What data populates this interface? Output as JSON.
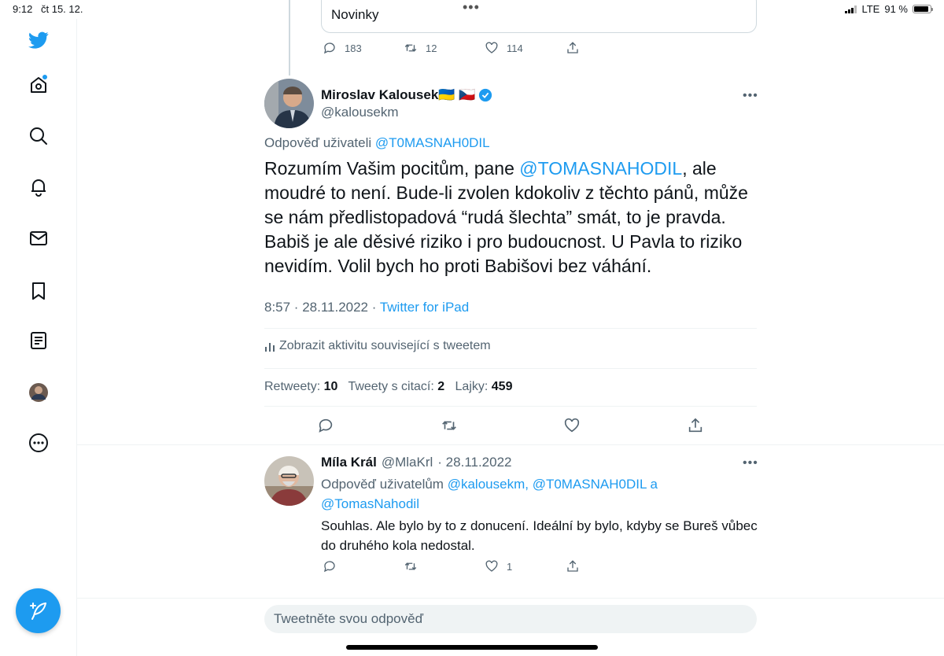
{
  "status_bar": {
    "time": "9:12",
    "date": "čt 15. 12.",
    "network": "LTE",
    "battery": "91 %",
    "battery_level": 0.91
  },
  "sidebar": {
    "items": [
      "twitter-logo",
      "home",
      "explore",
      "notifications",
      "messages",
      "bookmarks",
      "lists",
      "profile",
      "more"
    ],
    "compose_label": "Tweet"
  },
  "previous_tweet": {
    "card_text": "Novinky",
    "replies": "183",
    "retweets": "12",
    "likes": "114"
  },
  "main_tweet": {
    "author_name": "Miroslav Kalousek🇺🇦 🇨🇿",
    "handle": "@kalousekm",
    "reply_prefix": "Odpověď uživateli",
    "reply_to": "@T0MASNAH0DIL",
    "text_before": "Rozumím Vašim pocitům, pane ",
    "mention": "@TOMASNAHODIL",
    "text_after": ", ale moudré to není. Bude-li zvolen kdokoliv z těchto pánů, může se nám předlistopadová “rudá šlechta” smát, to je pravda. Babiš je ale děsivé riziko i pro budoucnost. U Pavla to riziko nevidím. Volil bych ho proti Babišovi bez váhání.",
    "time": "8:57 · 28.11.2022 · ",
    "source": "Twitter for iPad",
    "activity_label": "Zobrazit aktivitu související s tweetem",
    "retweets_label": "Retweety:",
    "retweets": "10",
    "quotes_label": "Tweety s citací:",
    "quotes": "2",
    "likes_label": "Lajky:",
    "likes": "459"
  },
  "reply_tweet": {
    "author_name": "Míla Král",
    "handle": "@MlaKrl",
    "date": "· 28.11.2022",
    "reply_prefix": "Odpověď uživatelům",
    "reply_to_1": "@kalousekm,",
    "reply_to_2": "@T0MASNAH0DIL",
    "reply_and": "a",
    "reply_to_3": "@TomasNahodil",
    "text": "Souhlas. Ale bylo by to z donucení. Ideální by bylo, kdyby se Bureš vůbec do druhého kola nedostal.",
    "replies": "",
    "retweets": "",
    "likes": "1"
  },
  "reply_box": {
    "placeholder": "Tweetněte svou odpověď"
  },
  "colors": {
    "accent": "#1d9bf0",
    "text": "#0f1419",
    "muted": "#536471",
    "border": "#eff3f4"
  }
}
